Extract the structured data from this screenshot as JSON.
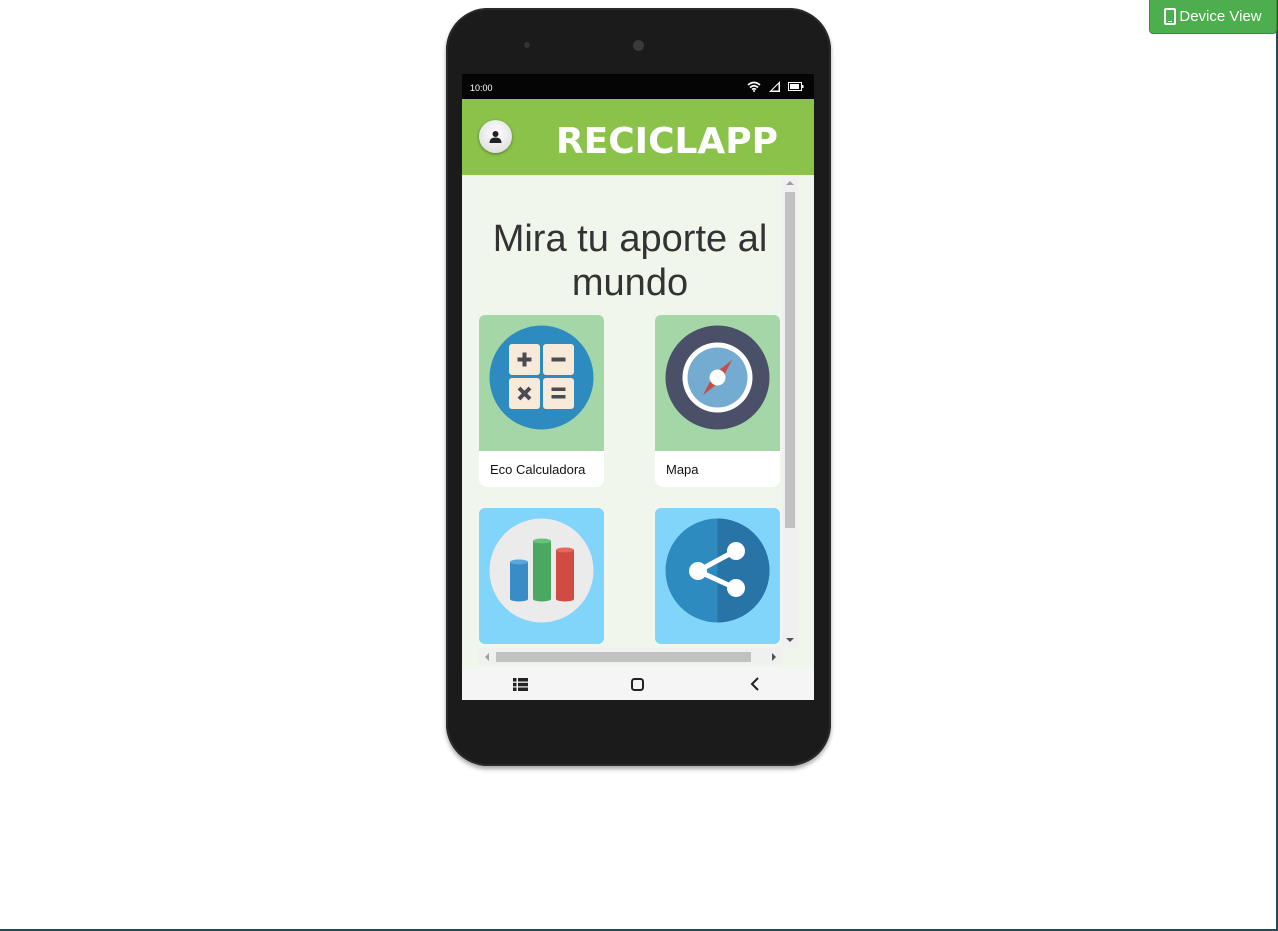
{
  "toolbar": {
    "device_view_label": "Device View",
    "device_view_icon": "mobile-phone-icon"
  },
  "statusbar": {
    "time": "10:00",
    "icons": [
      "wifi-icon",
      "signal-icon",
      "battery-icon"
    ]
  },
  "appbar": {
    "title": "RECICLAPP",
    "profile_icon": "user-icon"
  },
  "main": {
    "headline": "Mira tu aporte al mundo",
    "cards": [
      {
        "label": "Eco Calculadora",
        "icon": "calculator-icon",
        "bg": "#a5d6a7"
      },
      {
        "label": "Mapa",
        "icon": "compass-icon",
        "bg": "#a5d6a7"
      },
      {
        "label": "",
        "icon": "bar-chart-icon",
        "bg": "#81d4fa"
      },
      {
        "label": "",
        "icon": "share-icon",
        "bg": "#81d4fa"
      }
    ]
  },
  "navbar": {
    "icons": [
      "menu-list-icon",
      "home-square-icon",
      "back-chevron-icon"
    ]
  },
  "colors": {
    "accent": "#8bc34a",
    "button": "#4cae4c"
  }
}
